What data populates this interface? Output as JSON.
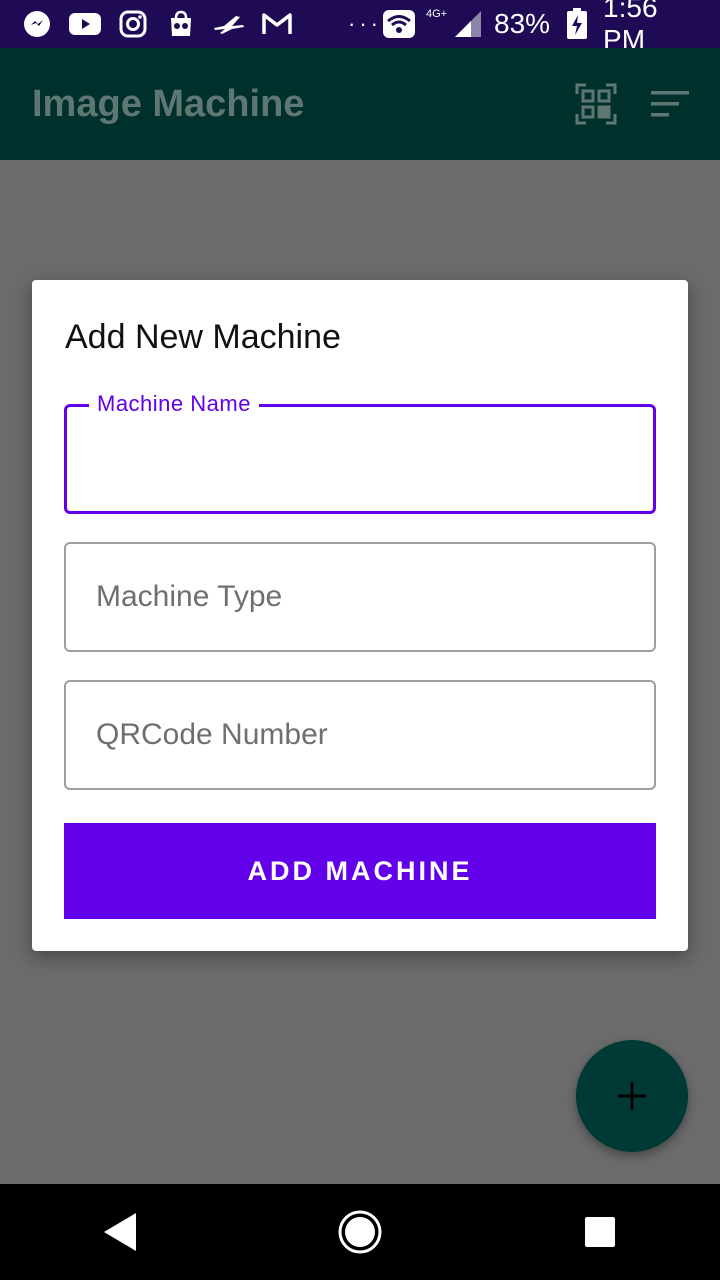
{
  "status_bar": {
    "network_type": "4G+",
    "battery_percent": "83%",
    "time": "1:56 PM",
    "overflow_dots": "···",
    "icons": [
      "messenger-icon",
      "youtube-icon",
      "instagram-icon",
      "shopping-icon",
      "airplane-icon",
      "gmail-icon",
      "wifi-icon",
      "signal-icon",
      "battery-charging-icon"
    ]
  },
  "app_bar": {
    "title": "Image Machine",
    "actions": [
      "qr-code-icon",
      "sort-icon"
    ]
  },
  "dialog": {
    "title": "Add New Machine",
    "fields": [
      {
        "label": "Machine Name",
        "value": "",
        "focused": true
      },
      {
        "label": "Machine Type",
        "value": ""
      },
      {
        "label": "QRCode Number",
        "value": ""
      }
    ],
    "submit_label": "ADD MACHINE"
  },
  "fab": {
    "icon": "plus-icon"
  },
  "nav_bar": {
    "buttons": [
      "back-icon",
      "home-icon",
      "recents-icon"
    ]
  },
  "colors": {
    "accent": "#6200ea",
    "app_bar": "#00302c",
    "status_bar": "#1e0a55",
    "scrim": "#6b6b6b",
    "fab": "#003a37"
  }
}
